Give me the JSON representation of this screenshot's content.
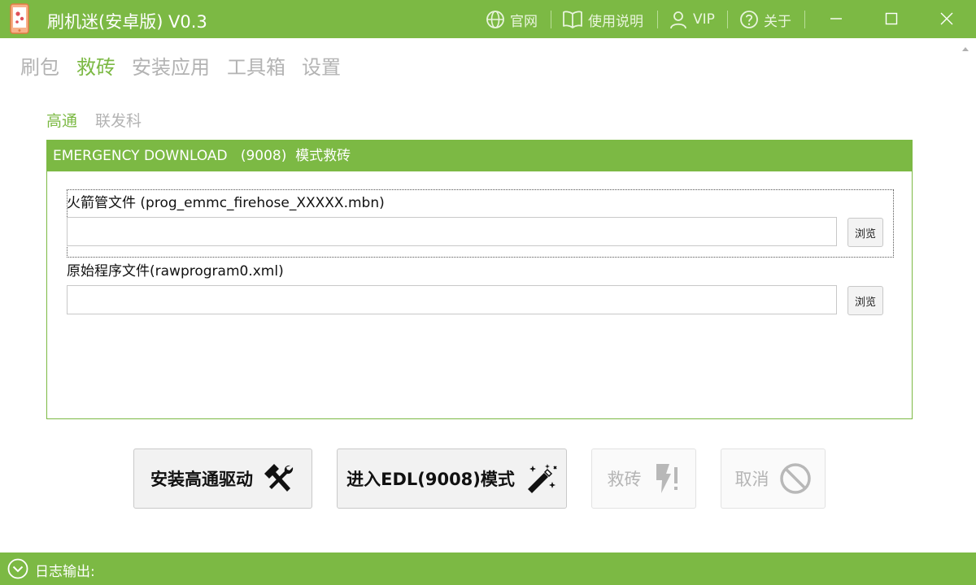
{
  "window": {
    "title": "刷机迷(安卓版) V0.3",
    "links": [
      {
        "label": "官网",
        "icon": "globe-icon"
      },
      {
        "label": "使用说明",
        "icon": "book-icon"
      },
      {
        "label": "VIP",
        "icon": "user-icon"
      },
      {
        "label": "关于",
        "icon": "question-circle-icon"
      }
    ],
    "controls": [
      "minimize-icon",
      "maximize-icon",
      "close-icon"
    ]
  },
  "nav": {
    "tabs": [
      "刷包",
      "救砖",
      "安装应用",
      "工具箱",
      "设置"
    ],
    "active": "救砖"
  },
  "subnav": {
    "tabs": [
      "高通",
      "联发科"
    ],
    "active": "高通"
  },
  "panel": {
    "title": "EMERGENCY DOWNLOAD   (9008)  模式救砖",
    "fields": [
      {
        "label": "火箭管文件 (prog_emmc_firehose_XXXXX.mbn)",
        "value": "",
        "button": "浏览"
      },
      {
        "label": "原始程序文件(rawprogram0.xml)",
        "value": "",
        "button": "浏览"
      }
    ]
  },
  "actions": [
    {
      "label": "安装高通驱动",
      "icon": "hammer-wrench-icon",
      "enabled": true
    },
    {
      "label": "进入EDL(9008)模式",
      "icon": "magic-wand-icon",
      "enabled": true
    },
    {
      "label": "救砖",
      "icon": "bolt-exclamation-icon",
      "enabled": false
    },
    {
      "label": "取消",
      "icon": "prohibited-icon",
      "enabled": false
    }
  ],
  "log": {
    "label": "日志输出:"
  },
  "colors": {
    "accent": "#7cb944",
    "inactive_text": "#b3b3b3"
  }
}
